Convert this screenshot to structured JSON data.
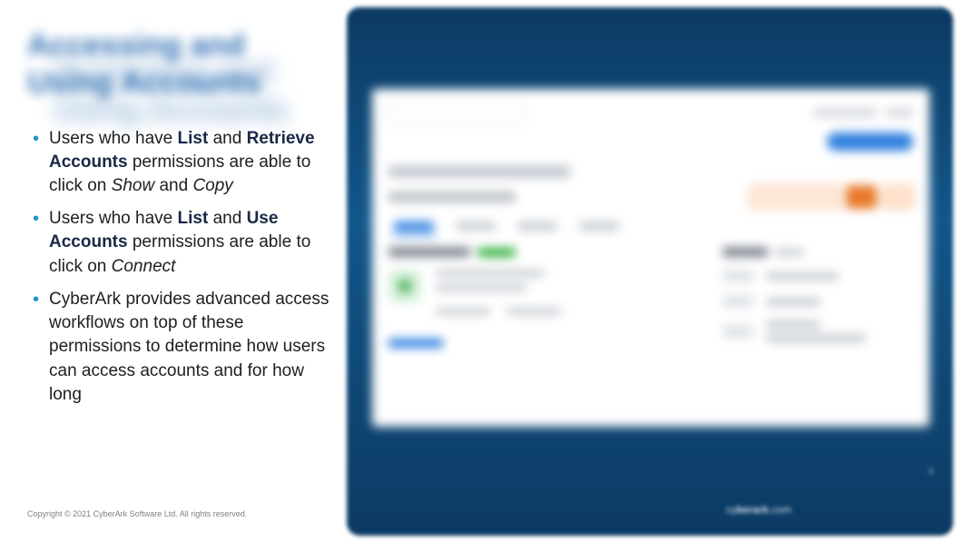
{
  "title_line1": "Accessing and",
  "title_line2": "Using Accounts",
  "bullets": {
    "b1": {
      "p1": "Users who have ",
      "list": "List",
      "and1": " and ",
      "retr": "Retrieve Accounts",
      "mid": " permissions are able to click on ",
      "show": "Show",
      "and2": " and ",
      "copy": "Copy"
    },
    "b2": {
      "p1": "Users who have ",
      "list": "List",
      "and1": " and ",
      "use": "Use Accounts",
      "mid": " permissions are able to click on ",
      "connect": "Connect"
    },
    "b3": {
      "text": "CyberArk provides advanced access workflows on top of these permissions to determine how users can access accounts and for how long"
    }
  },
  "copyright": "Copyright © 2021 CyberArk Software Ltd. All rights reserved.",
  "brand_prefix": "cy",
  "brand_bold": "berark",
  "brand_suffix": ".com",
  "page_number": "3"
}
